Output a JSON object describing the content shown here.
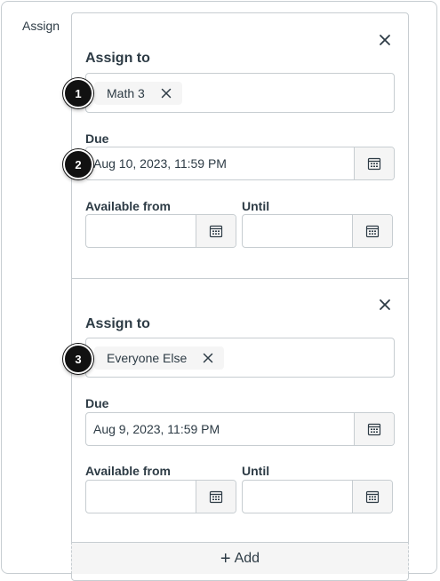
{
  "assign_label": "Assign",
  "cards": [
    {
      "title": "Assign to",
      "chip": "Math 3",
      "due_label": "Due",
      "due_value": "Aug 10, 2023, 11:59 PM",
      "available_from_label": "Available from",
      "until_label": "Until",
      "badge_chip": "1",
      "badge_due": "2"
    },
    {
      "title": "Assign to",
      "chip": "Everyone Else",
      "due_label": "Due",
      "due_value": "Aug 9, 2023, 11:59 PM",
      "available_from_label": "Available from",
      "until_label": "Until",
      "badge_chip": "3"
    }
  ],
  "add": {
    "plus": "+",
    "label": "Add"
  },
  "icons": {
    "close": "close-icon",
    "calendar": "calendar-icon",
    "remove_chip": "x-icon"
  },
  "colors": {
    "text": "#2d3b45",
    "border": "#c7cdd1",
    "chip_bg": "#f5f5f5",
    "badge_bg": "#111111"
  }
}
